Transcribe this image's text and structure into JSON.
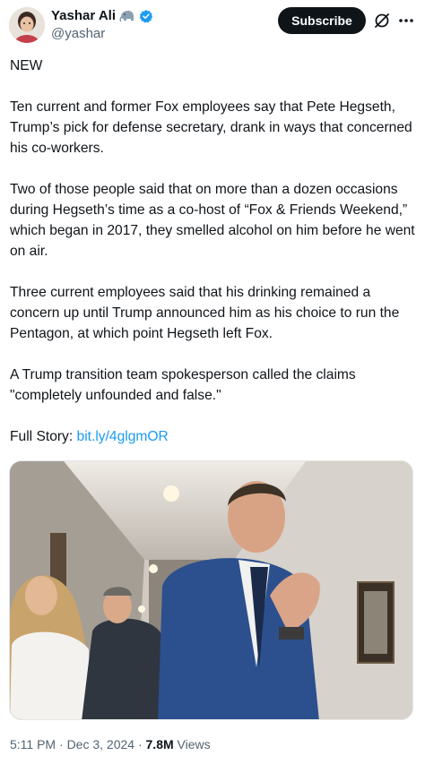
{
  "author": {
    "display_name": "Yashar Ali",
    "handle": "@yashar",
    "emoji": "elephant-icon",
    "verified": true,
    "verified_color": "#1d9bf0"
  },
  "header": {
    "subscribe_label": "Subscribe",
    "grok_icon": "grok-icon",
    "more_icon": "more-icon"
  },
  "tweet": {
    "paragraphs": [
      "NEW",
      "Ten current and former Fox employees say that Pete Hegseth, Trump’s pick for defense secretary, drank in ways that concerned his co-workers.",
      "Two of those people said that on more than a dozen occasions during Hegseth’s time as a co-host of “Fox & Friends Weekend,” which began in 2017, they smelled alcohol on him before he went on air.",
      "Three current employees said that his drinking remained a concern up until Trump announced him as his choice to run the Pentagon, at which point Hegseth left Fox.",
      "A Trump transition team spokesperson called the claims \"completely unfounded and false.\""
    ],
    "full_story_label": "Full Story: ",
    "full_story_link": "bit.ly/4glgmOR",
    "link_color": "#1d9bf0"
  },
  "meta": {
    "time": "5:11 PM",
    "separator": " · ",
    "date": "Dec 3, 2024",
    "views_count": "7.8M",
    "views_label": " Views"
  }
}
